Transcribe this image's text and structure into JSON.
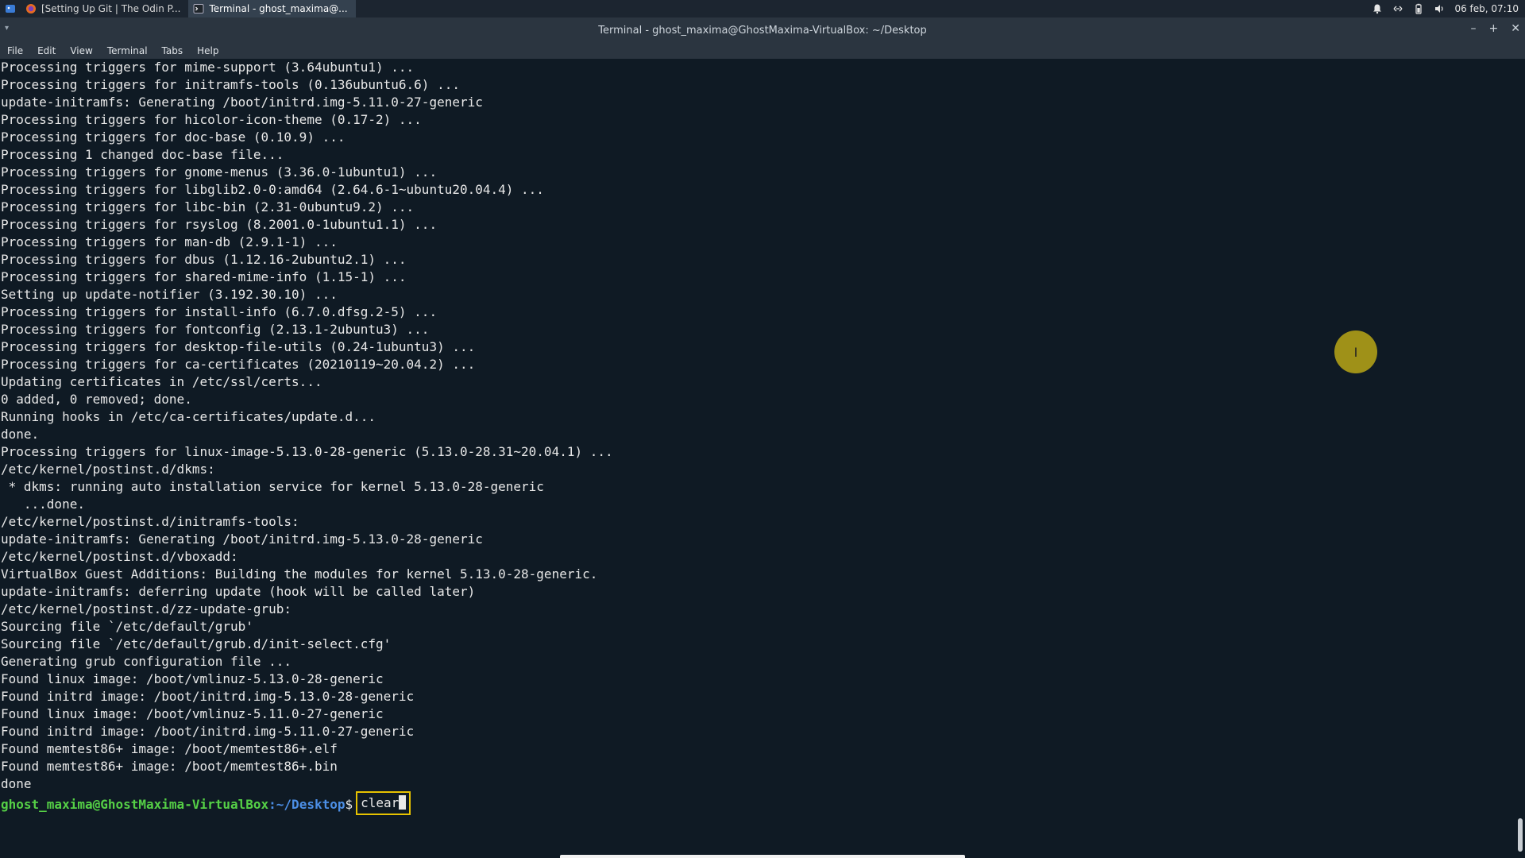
{
  "taskbar": {
    "tasks": [
      {
        "label": "[Setting Up Git | The Odin P...",
        "icon": "firefox-icon",
        "active": false
      },
      {
        "label": "Terminal - ghost_maxima@...",
        "icon": "terminal-icon",
        "active": true
      }
    ],
    "clock": "06 feb, 07:10"
  },
  "window": {
    "title": "Terminal - ghost_maxima@GhostMaxima-VirtualBox: ~/Desktop"
  },
  "menubar": {
    "items": [
      "File",
      "Edit",
      "View",
      "Terminal",
      "Tabs",
      "Help"
    ]
  },
  "terminal": {
    "lines": [
      "Processing triggers for mime-support (3.64ubuntu1) ...",
      "Processing triggers for initramfs-tools (0.136ubuntu6.6) ...",
      "update-initramfs: Generating /boot/initrd.img-5.11.0-27-generic",
      "Processing triggers for hicolor-icon-theme (0.17-2) ...",
      "Processing triggers for doc-base (0.10.9) ...",
      "Processing 1 changed doc-base file...",
      "Processing triggers for gnome-menus (3.36.0-1ubuntu1) ...",
      "Processing triggers for libglib2.0-0:amd64 (2.64.6-1~ubuntu20.04.4) ...",
      "Processing triggers for libc-bin (2.31-0ubuntu9.2) ...",
      "Processing triggers for rsyslog (8.2001.0-1ubuntu1.1) ...",
      "Processing triggers for man-db (2.9.1-1) ...",
      "Processing triggers for dbus (1.12.16-2ubuntu2.1) ...",
      "Processing triggers for shared-mime-info (1.15-1) ...",
      "Setting up update-notifier (3.192.30.10) ...",
      "Processing triggers for install-info (6.7.0.dfsg.2-5) ...",
      "Processing triggers for fontconfig (2.13.1-2ubuntu3) ...",
      "Processing triggers for desktop-file-utils (0.24-1ubuntu3) ...",
      "Processing triggers for ca-certificates (20210119~20.04.2) ...",
      "Updating certificates in /etc/ssl/certs...",
      "0 added, 0 removed; done.",
      "Running hooks in /etc/ca-certificates/update.d...",
      "done.",
      "Processing triggers for linux-image-5.13.0-28-generic (5.13.0-28.31~20.04.1) ...",
      "/etc/kernel/postinst.d/dkms:",
      " * dkms: running auto installation service for kernel 5.13.0-28-generic",
      "   ...done.",
      "/etc/kernel/postinst.d/initramfs-tools:",
      "update-initramfs: Generating /boot/initrd.img-5.13.0-28-generic",
      "/etc/kernel/postinst.d/vboxadd:",
      "VirtualBox Guest Additions: Building the modules for kernel 5.13.0-28-generic.",
      "update-initramfs: deferring update (hook will be called later)",
      "/etc/kernel/postinst.d/zz-update-grub:",
      "Sourcing file `/etc/default/grub'",
      "Sourcing file `/etc/default/grub.d/init-select.cfg'",
      "Generating grub configuration file ...",
      "Found linux image: /boot/vmlinuz-5.13.0-28-generic",
      "Found initrd image: /boot/initrd.img-5.13.0-28-generic",
      "Found linux image: /boot/vmlinuz-5.11.0-27-generic",
      "Found initrd image: /boot/initrd.img-5.11.0-27-generic",
      "Found memtest86+ image: /boot/memtest86+.elf",
      "Found memtest86+ image: /boot/memtest86+.bin",
      "done"
    ],
    "prompt": {
      "user_host": "ghost_maxima@GhostMaxima-VirtualBox",
      "path": ":~/Desktop",
      "symbol": "$",
      "command": "clear"
    }
  },
  "colors": {
    "background": "#0f1a24",
    "prompt_user": "#55d046",
    "prompt_path": "#4c8fe6",
    "highlight_box": "#e6c200"
  }
}
